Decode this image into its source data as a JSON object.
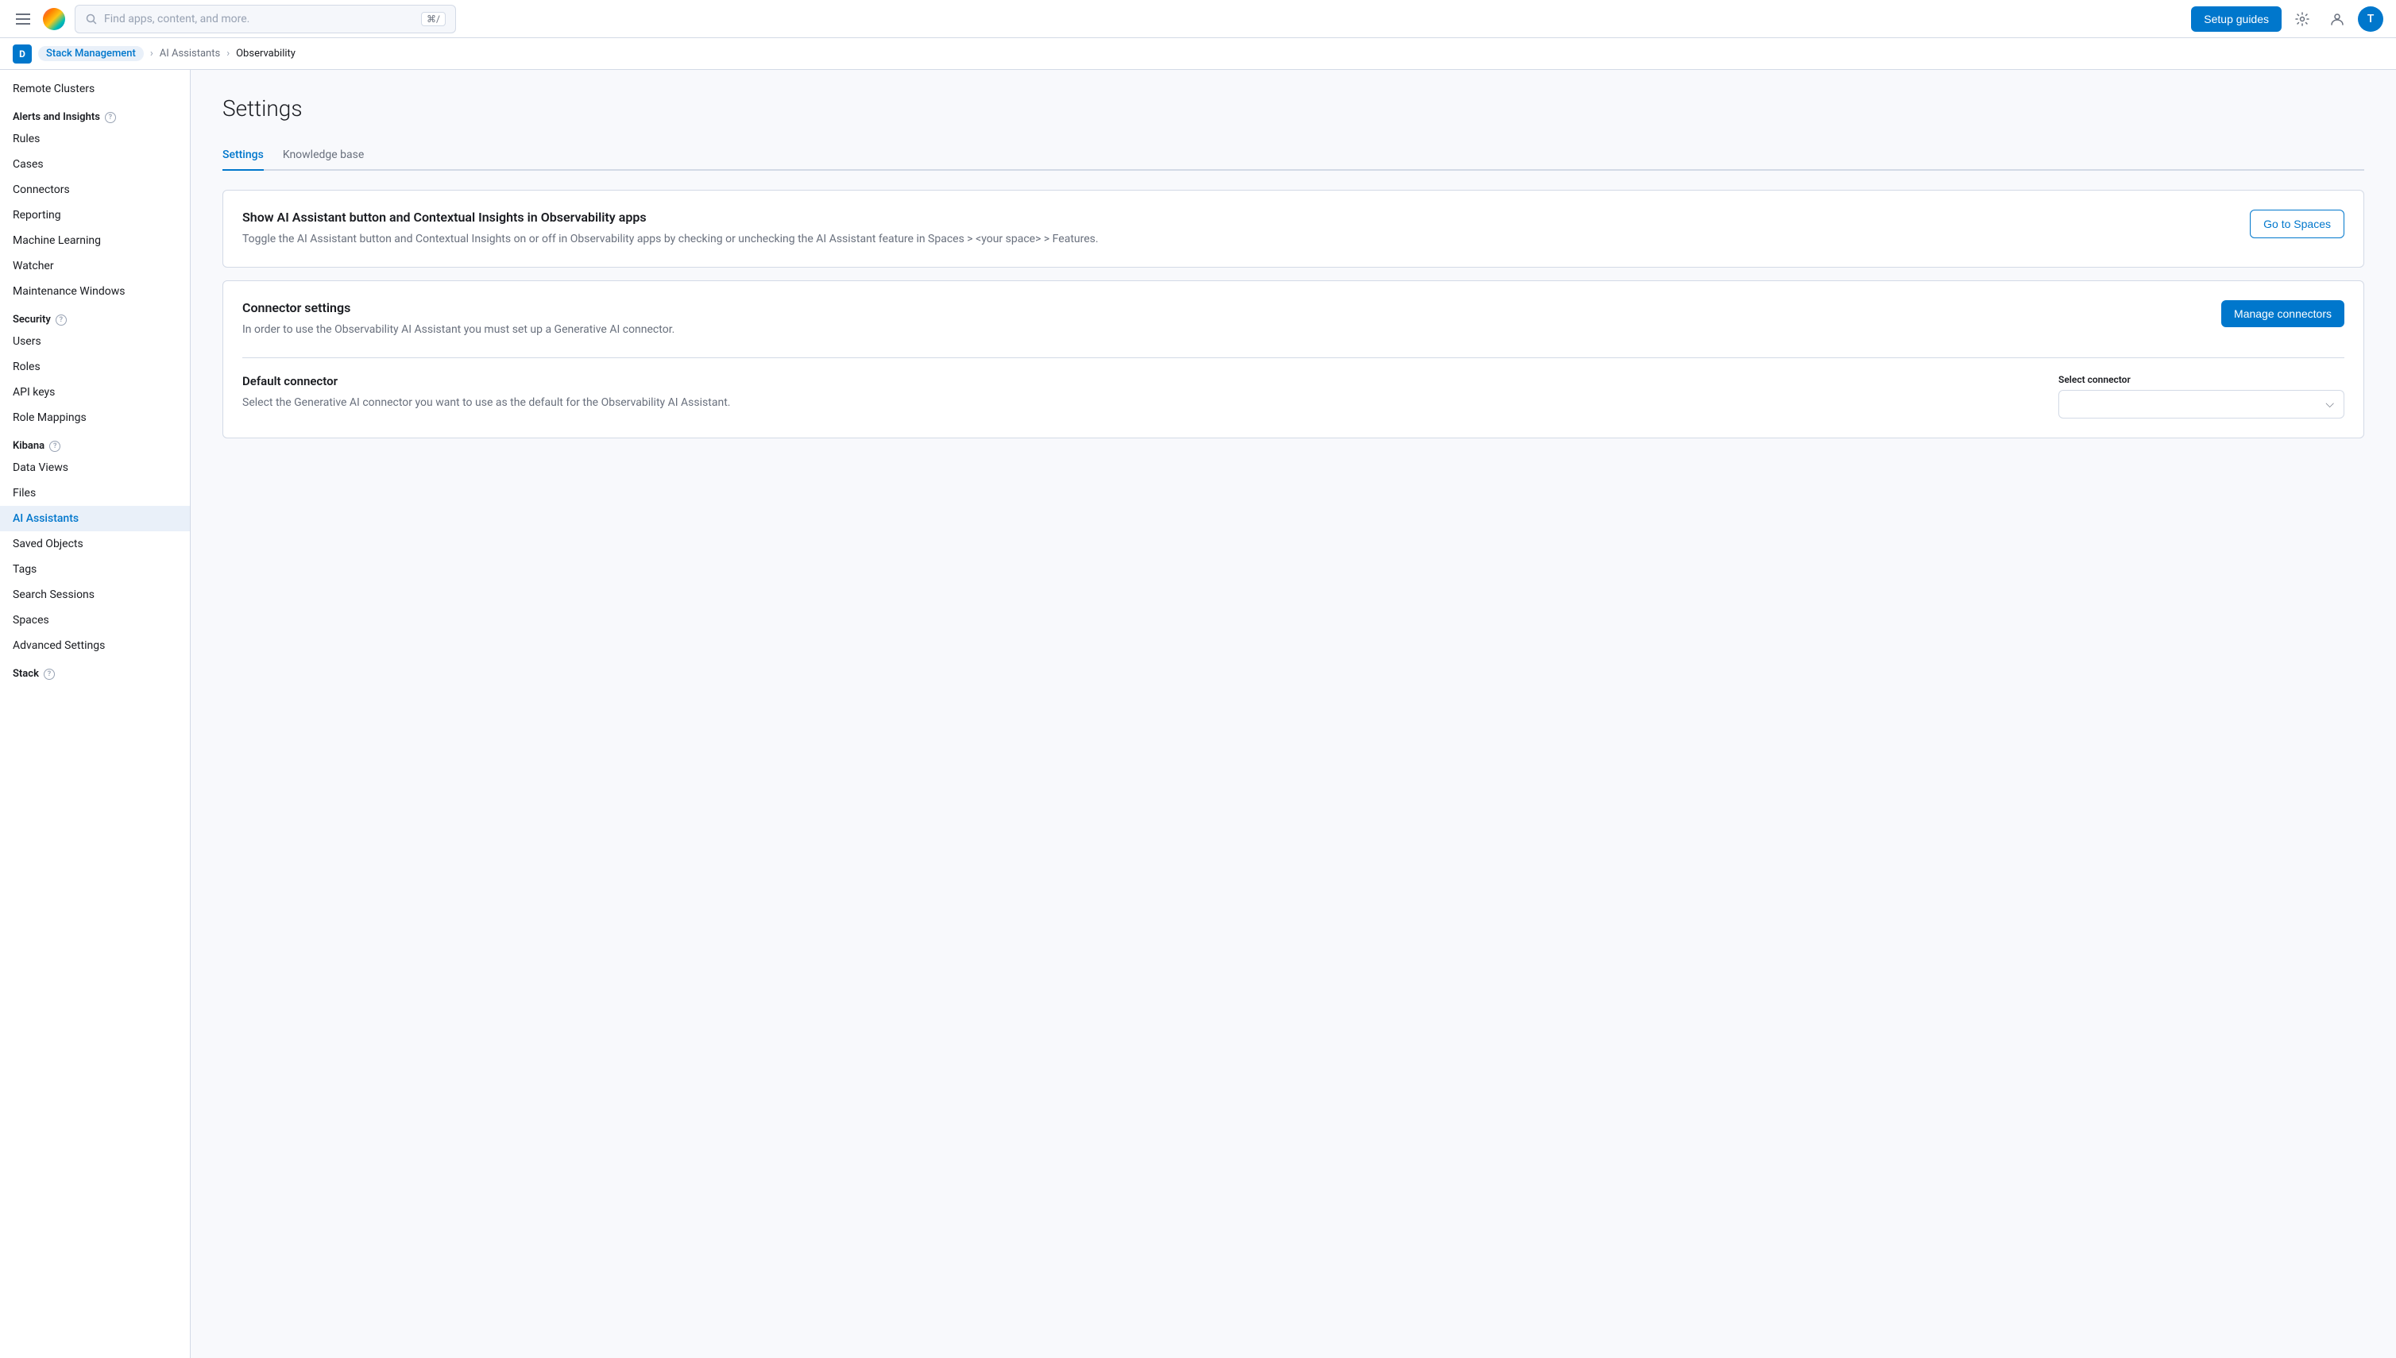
{
  "nav": {
    "search_placeholder": "Find apps, content, and more.",
    "search_shortcut": "⌘/",
    "setup_guides_label": "Setup guides",
    "user_initial": "T"
  },
  "breadcrumb": {
    "items": [
      {
        "label": "Stack Management",
        "active": false
      },
      {
        "label": "AI Assistants",
        "active": false
      },
      {
        "label": "Observability",
        "active": true
      }
    ]
  },
  "page": {
    "title": "Settings",
    "tabs": [
      {
        "label": "Settings",
        "active": true
      },
      {
        "label": "Knowledge base",
        "active": false
      }
    ]
  },
  "sidebar": {
    "remote_clusters": "Remote Clusters",
    "sections": [
      {
        "title": "Alerts and Insights",
        "has_help": true,
        "items": [
          {
            "label": "Rules",
            "active": false
          },
          {
            "label": "Cases",
            "active": false
          },
          {
            "label": "Connectors",
            "active": false
          },
          {
            "label": "Reporting",
            "active": false
          },
          {
            "label": "Machine Learning",
            "active": false
          },
          {
            "label": "Watcher",
            "active": false
          },
          {
            "label": "Maintenance Windows",
            "active": false
          }
        ]
      },
      {
        "title": "Security",
        "has_help": true,
        "items": [
          {
            "label": "Users",
            "active": false
          },
          {
            "label": "Roles",
            "active": false
          },
          {
            "label": "API keys",
            "active": false
          },
          {
            "label": "Role Mappings",
            "active": false
          }
        ]
      },
      {
        "title": "Kibana",
        "has_help": true,
        "items": [
          {
            "label": "Data Views",
            "active": false
          },
          {
            "label": "Files",
            "active": false
          },
          {
            "label": "AI Assistants",
            "active": true
          },
          {
            "label": "Saved Objects",
            "active": false
          },
          {
            "label": "Tags",
            "active": false
          },
          {
            "label": "Search Sessions",
            "active": false
          },
          {
            "label": "Spaces",
            "active": false
          },
          {
            "label": "Advanced Settings",
            "active": false
          }
        ]
      },
      {
        "title": "Stack",
        "has_help": true,
        "items": []
      }
    ]
  },
  "settings_card": {
    "title": "Show AI Assistant button and Contextual Insights in Observability apps",
    "description": "Toggle the AI Assistant button and Contextual Insights on or off in Observability apps by checking or unchecking the AI Assistant feature in Spaces > <your space> > Features.",
    "button_label": "Go to Spaces"
  },
  "connector_card": {
    "title": "Connector settings",
    "description": "In order to use the Observability AI Assistant you must set up a Generative AI connector.",
    "button_label": "Manage connectors",
    "sub_section": {
      "title": "Default connector",
      "description": "Select the Generative AI connector you want to use as the default for the Observability AI Assistant.",
      "select_label": "Select connector",
      "select_placeholder": ""
    }
  }
}
